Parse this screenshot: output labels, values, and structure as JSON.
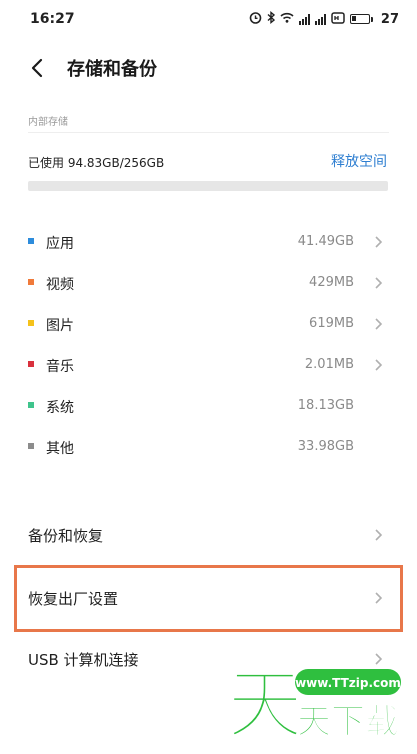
{
  "status_bar": {
    "time": "16:27",
    "battery": "27",
    "icons": [
      "alarm-icon",
      "bluetooth-icon",
      "wifi-icon",
      "signal-icon",
      "signal-icon",
      "hd-call-icon",
      "battery-icon"
    ]
  },
  "header": {
    "title": "存储和备份"
  },
  "storage": {
    "section_label": "内部存储",
    "used_text": "已使用 94.83GB/256GB",
    "free_space_label": "释放空间"
  },
  "categories": [
    {
      "name": "应用",
      "size": "41.49GB",
      "color": "#2d8cdc",
      "has_chevron": true
    },
    {
      "name": "视频",
      "size": "429MB",
      "color": "#f07a3a",
      "has_chevron": true
    },
    {
      "name": "图片",
      "size": "619MB",
      "color": "#f5c21b",
      "has_chevron": true
    },
    {
      "name": "音乐",
      "size": "2.01MB",
      "color": "#d9313d",
      "has_chevron": true
    },
    {
      "name": "系统",
      "size": "18.13GB",
      "color": "#3fc48c",
      "has_chevron": false
    },
    {
      "name": "其他",
      "size": "33.98GB",
      "color": "#8c8c8c",
      "has_chevron": false
    }
  ],
  "settings": {
    "backup_restore": "备份和恢复",
    "factory_reset": "恢复出厂设置",
    "usb_connect": "USB 计算机连接"
  },
  "watermark": {
    "logo_char": "天",
    "url": "www.TTzip.com",
    "text": "天下载"
  },
  "colors": {
    "accent": "#2f7fd1",
    "highlight": "#e8774a",
    "watermark_green": "#2fbf3f"
  }
}
